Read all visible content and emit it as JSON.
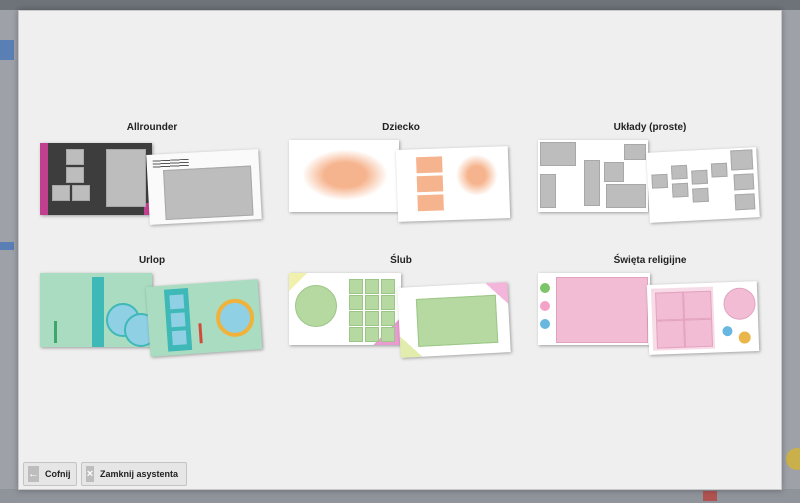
{
  "wizard": {
    "categories": [
      {
        "label": "Allrounder"
      },
      {
        "label": "Dziecko"
      },
      {
        "label": "Układy (proste)"
      },
      {
        "label": "Urlop"
      },
      {
        "label": "Ślub"
      },
      {
        "label": "Święta religijne"
      }
    ],
    "footer": {
      "back_label": "Cofnij",
      "close_label": "Zamknij asystenta"
    }
  },
  "colors": {
    "dialog_bg": "#efefef",
    "placeholder_gray": "#bdbdbd",
    "allrounder_pink": "#c0408f",
    "dziecko_peach": "#f6b48e",
    "urlop_mint": "#a9dcc0",
    "urlop_teal": "#3fb8b8",
    "slub_green": "#b5d9a0",
    "swieta_pink": "#f1bcd4"
  },
  "icons": [
    "arrow-left-icon",
    "close-icon"
  ]
}
